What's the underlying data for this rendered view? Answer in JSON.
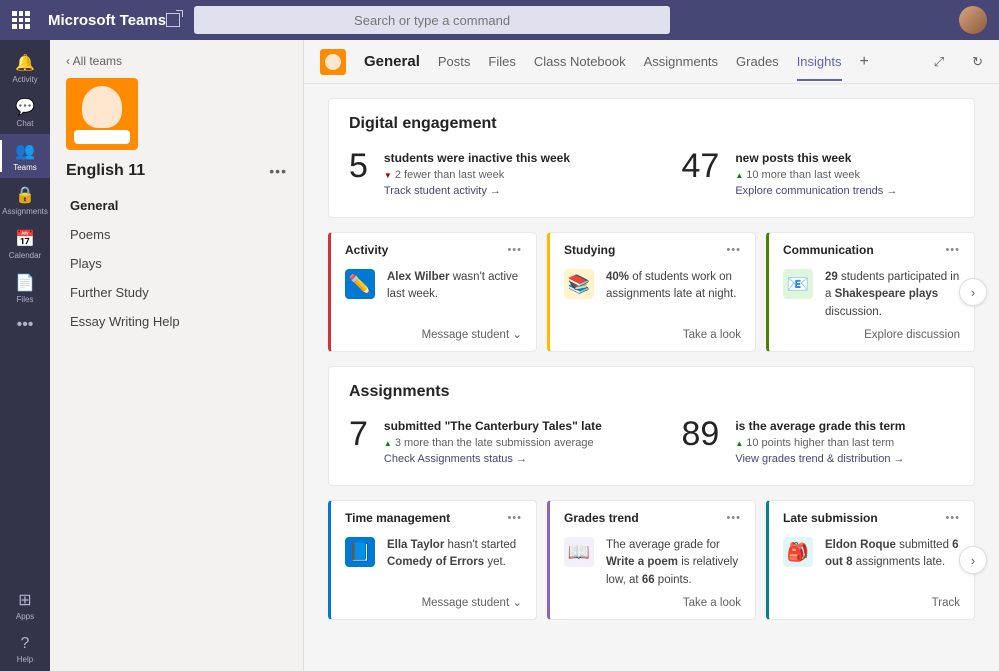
{
  "topbar": {
    "app_title": "Microsoft Teams",
    "search_placeholder": "Search or type a command"
  },
  "rail": [
    {
      "label": "Activity",
      "icon": "🔔"
    },
    {
      "label": "Chat",
      "icon": "💬"
    },
    {
      "label": "Teams",
      "icon": "👥"
    },
    {
      "label": "Assignments",
      "icon": "🔒"
    },
    {
      "label": "Calendar",
      "icon": "📅"
    },
    {
      "label": "Files",
      "icon": "📄"
    }
  ],
  "rail_bottom": [
    {
      "label": "Apps",
      "icon": "⊞"
    },
    {
      "label": "Help",
      "icon": "?"
    }
  ],
  "sidebar": {
    "back": "‹  All teams",
    "team_name": "English 11",
    "channels": [
      "General",
      "Poems",
      "Plays",
      "Further Study",
      "Essay Writing Help"
    ],
    "active_channel": 0
  },
  "tabs": {
    "channel": "General",
    "items": [
      "Posts",
      "Files",
      "Class Notebook",
      "Assignments",
      "Grades",
      "Insights"
    ],
    "active": 5
  },
  "engagement": {
    "title": "Digital engagement",
    "metrics": [
      {
        "num": "5",
        "label": "students were inactive this week",
        "delta": "2 fewer than last week",
        "dir": "down",
        "link": "Track student activity"
      },
      {
        "num": "47",
        "label": "new posts this week",
        "delta": "10 more than last week",
        "dir": "up",
        "link": "Explore communication trends"
      }
    ]
  },
  "insight_cards1": [
    {
      "title": "Activity",
      "color": "red",
      "icon": "✏️",
      "icon_bg": "#0078d4",
      "text_html": "<b>Alex Wilber</b> wasn't active last week.",
      "action": "Message student",
      "dd": true
    },
    {
      "title": "Studying",
      "color": "yellow",
      "icon": "📚",
      "icon_bg": "#fff4ce",
      "text_html": "<b>40%</b> of students work on assignments late at night.",
      "action": "Take a look"
    },
    {
      "title": "Communication",
      "color": "green",
      "icon": "📧",
      "icon_bg": "#dff6dd",
      "text_html": "<b>29</b> students participated in a <b>Shakespeare plays</b> discussion.",
      "action": "Explore discussion"
    }
  ],
  "assignments": {
    "title": "Assignments",
    "metrics": [
      {
        "num": "7",
        "label": "submitted \"The Canterbury Tales\" late",
        "delta": "3 more than the late submission average",
        "dir": "up",
        "link": "Check Assignments status"
      },
      {
        "num": "89",
        "label": "is the average grade this term",
        "delta": "10 points higher than last term",
        "dir": "up",
        "link": "View grades trend & distribution"
      }
    ]
  },
  "insight_cards2": [
    {
      "title": "Time management",
      "color": "blue",
      "icon": "📘",
      "icon_bg": "#0078d4",
      "text_html": "<b>Ella Taylor</b> hasn't started <b>Comedy of Errors</b> yet.",
      "action": "Message student",
      "dd": true
    },
    {
      "title": "Grades trend",
      "color": "purple",
      "icon": "📖",
      "icon_bg": "#f3f0fa",
      "text_html": "The average grade for <b>Write a poem</b> is relatively low, at <b>66</b> points.",
      "action": "Take a look"
    },
    {
      "title": "Late submission",
      "color": "teal",
      "icon": "🎒",
      "icon_bg": "#e0f5f5",
      "text_html": "<b>Eldon Roque</b> submitted <b>6 out 8</b> assignments late.",
      "action": "Track"
    }
  ]
}
